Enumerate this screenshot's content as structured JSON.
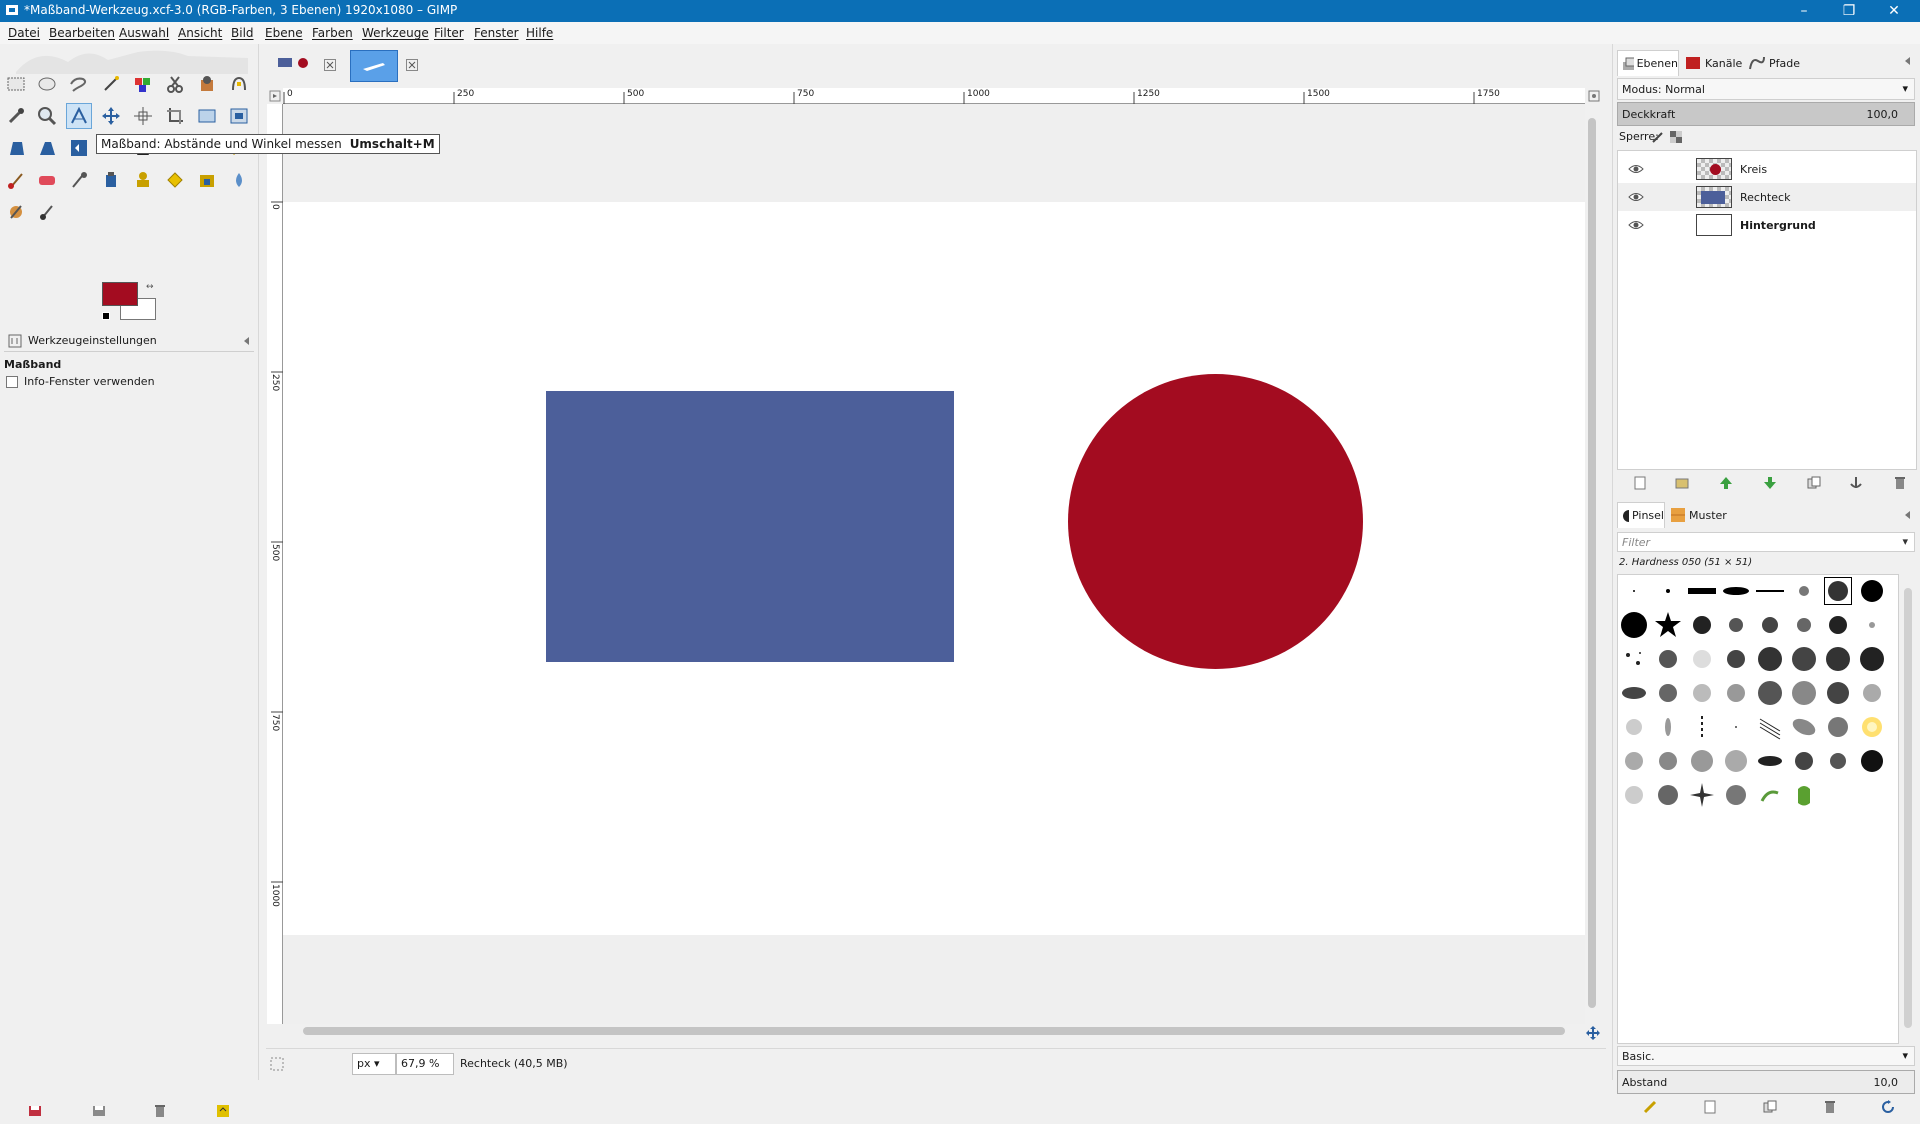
{
  "window": {
    "title": "*Maßband-Werkzeug.xcf-3.0 (RGB-Farben, 3 Ebenen) 1920x1080 – GIMP",
    "minimize": "–",
    "maximize": "❐",
    "close": "✕"
  },
  "menu": [
    "Datei",
    "Bearbeiten",
    "Auswahl",
    "Ansicht",
    "Bild",
    "Ebene",
    "Farben",
    "Werkzeuge",
    "Filter",
    "Fenster",
    "Hilfe"
  ],
  "tooltip": {
    "text": "Maßband: Abstände und Winkel messen",
    "shortcut": "Umschalt+M"
  },
  "colors": {
    "foreground": "#a30c20",
    "background": "#ffffff",
    "rect": "#4c5f9a",
    "circle": "#a30c20",
    "accent": "#0b6fb6"
  },
  "tool_options": {
    "tab_label": "Werkzeugeinstellungen",
    "tool_name": "Maßband",
    "checkbox_label": "Info-Fenster verwenden",
    "checkbox_checked": false
  },
  "ruler_top": [
    "0",
    "250",
    "500",
    "750",
    "1000",
    "1250",
    "1500",
    "1750"
  ],
  "ruler_left": [
    "0",
    "250",
    "500",
    "750",
    "1000"
  ],
  "status": {
    "unit": "px",
    "zoom": "67,9 %",
    "info": "Rechteck (40,5 MB)"
  },
  "dock": {
    "tabs": [
      "Ebenen",
      "Kanäle",
      "Pfade"
    ],
    "mode_label": "Modus: Normal",
    "opacity_label": "Deckkraft",
    "opacity_value": "100,0",
    "lock_label": "Sperre:",
    "layers": [
      {
        "name": "Kreis",
        "bold": false
      },
      {
        "name": "Rechteck",
        "bold": false
      },
      {
        "name": "Hintergrund",
        "bold": true
      }
    ],
    "brush_tabs": [
      "Pinsel",
      "Muster"
    ],
    "filter_placeholder": "Filter",
    "brush_name": "2. Hardness 050 (51 × 51)",
    "preset": "Basic.",
    "spacing_label": "Abstand",
    "spacing_value": "10,0"
  }
}
